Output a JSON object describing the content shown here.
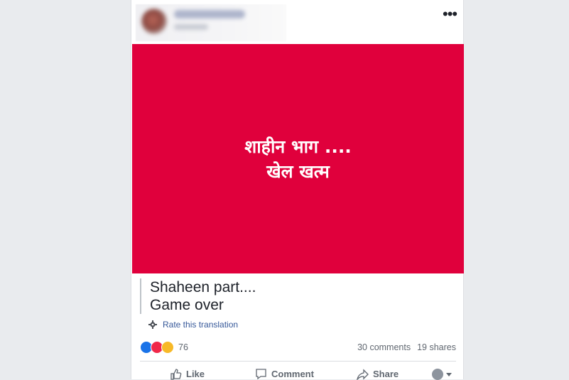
{
  "banner": {
    "line1": "शाहीन भाग ....",
    "line2": "खेल खत्म",
    "bg": "#e0003c"
  },
  "caption": {
    "line1": "Shaheen part....",
    "line2": "Game over"
  },
  "translation": {
    "rate_label": "Rate this translation"
  },
  "stats": {
    "reactions_count": "76",
    "comments": "30 comments",
    "shares": "19 shares"
  },
  "actions": {
    "like": "Like",
    "comment": "Comment",
    "share": "Share"
  },
  "icons": [
    "more-options-icon",
    "gear-icon",
    "like-reaction-icon",
    "love-reaction-icon",
    "haha-reaction-icon",
    "thumbs-up-icon",
    "speech-bubble-icon",
    "share-arrow-icon",
    "viewer-avatar-icon",
    "caret-down-icon"
  ]
}
